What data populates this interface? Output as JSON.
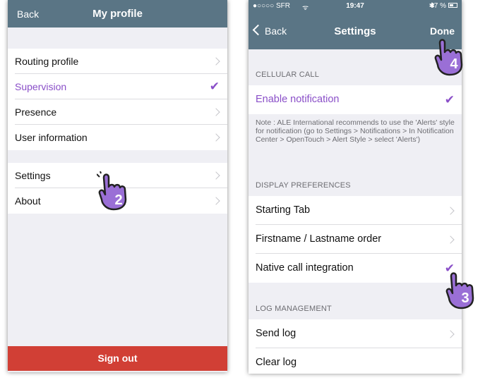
{
  "left": {
    "navbar": {
      "back_label": "Back",
      "title": "My profile"
    },
    "group1": [
      {
        "label": "Routing profile",
        "accessory": "chevron"
      },
      {
        "label": "Supervision",
        "accessory": "check"
      },
      {
        "label": "Presence",
        "accessory": "chevron"
      },
      {
        "label": "User information",
        "accessory": "chevron"
      }
    ],
    "group2": [
      {
        "label": "Settings",
        "accessory": "chevron"
      },
      {
        "label": "About",
        "accessory": "chevron"
      }
    ],
    "sign_out_label": "Sign out"
  },
  "right": {
    "status_bar": {
      "carrier": "●○○○○ SFR",
      "time": "19:47",
      "battery": "47 %"
    },
    "navbar": {
      "back_label": "Back",
      "title": "Settings",
      "done_label": "Done"
    },
    "sections": {
      "cellular_header": "CELLULAR CALL",
      "enable_notification": "Enable notification",
      "note": "Note : ALE International recommends to use the 'Alerts' style for notification (go to Settings > Notifications > In Notification Center > OpenTouch > Alert Style > select 'Alerts')",
      "display_header": "DISPLAY PREFERENCES",
      "starting_tab": "Starting Tab",
      "name_order": "Firstname / Lastname order",
      "native_call": "Native call integration",
      "log_header": "LOG MANAGEMENT",
      "send_log": "Send log",
      "clear_log": "Clear log"
    }
  },
  "callouts": {
    "step2": "2",
    "step3": "3",
    "step4": "4"
  },
  "colors": {
    "navbar": "#5a7585",
    "accent": "#8a4fc8",
    "sign_out": "#d13f35",
    "callout": "#9a6fd6"
  }
}
